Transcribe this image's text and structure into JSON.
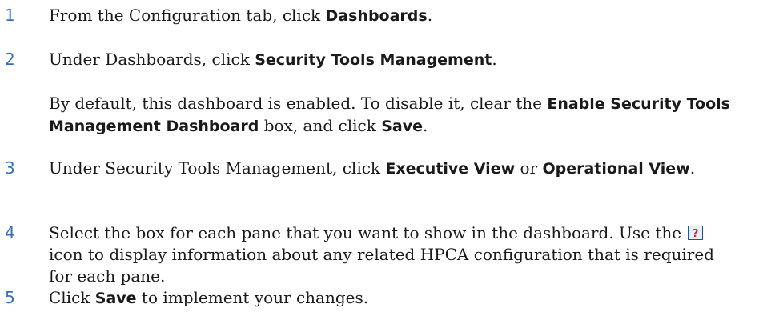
{
  "steps": [
    {
      "number": "1",
      "text_before": "From the Configuration tab, click ",
      "bold": "Dashboards",
      "text_after": "."
    },
    {
      "number": "2",
      "text_before": "Under Dashboards, click ",
      "bold": "Security Tools Management",
      "text_after": ".",
      "note": {
        "text_before": "By default, this dashboard is enabled. To disable it, clear the ",
        "bold1": "Enable Security Tools Management Dashboard",
        "text_mid": " box, and click ",
        "bold2": "Save",
        "text_after": "."
      }
    },
    {
      "number": "3",
      "text_before": "Under Security Tools Management, click ",
      "bold1": "Executive View",
      "text_mid": " or ",
      "bold2": "Operational View",
      "text_after": "."
    },
    {
      "number": "4",
      "text_before": "Select the box for each pane that you want to show in the dashboard. Use the ",
      "icon": "help-icon",
      "text_after": " icon to display information about any related HPCA configuration that is required for each pane."
    },
    {
      "number": "5",
      "text_before": "Click ",
      "bold": "Save",
      "text_after": " to implement your changes."
    }
  ],
  "colors": {
    "step_number": "#3a6fb8",
    "body_text": "#1a1a1a",
    "icon_border": "#2d4f8c"
  }
}
